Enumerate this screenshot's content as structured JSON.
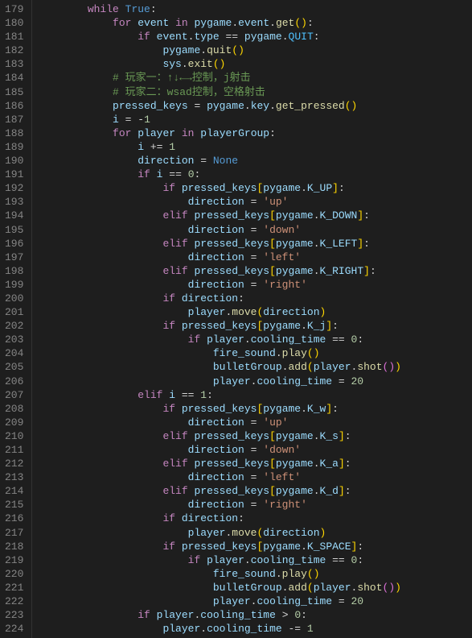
{
  "lineStart": 179,
  "lineEnd": 224,
  "code": [
    {
      "indent": 2,
      "tokens": [
        [
          "kw",
          "while"
        ],
        [
          "op",
          " "
        ],
        [
          "bool",
          "True"
        ],
        [
          "punc",
          ":"
        ]
      ]
    },
    {
      "indent": 3,
      "tokens": [
        [
          "kw",
          "for"
        ],
        [
          "op",
          " "
        ],
        [
          "var",
          "event"
        ],
        [
          "op",
          " "
        ],
        [
          "kw",
          "in"
        ],
        [
          "op",
          " "
        ],
        [
          "var",
          "pygame"
        ],
        [
          "punc",
          "."
        ],
        [
          "var",
          "event"
        ],
        [
          "punc",
          "."
        ],
        [
          "func",
          "get"
        ],
        [
          "paren",
          "()"
        ],
        [
          "punc",
          ":"
        ]
      ]
    },
    {
      "indent": 4,
      "tokens": [
        [
          "kw",
          "if"
        ],
        [
          "op",
          " "
        ],
        [
          "var",
          "event"
        ],
        [
          "punc",
          "."
        ],
        [
          "var",
          "type"
        ],
        [
          "op",
          " == "
        ],
        [
          "var",
          "pygame"
        ],
        [
          "punc",
          "."
        ],
        [
          "const",
          "QUIT"
        ],
        [
          "punc",
          ":"
        ]
      ]
    },
    {
      "indent": 5,
      "tokens": [
        [
          "var",
          "pygame"
        ],
        [
          "punc",
          "."
        ],
        [
          "func",
          "quit"
        ],
        [
          "paren",
          "()"
        ]
      ]
    },
    {
      "indent": 5,
      "tokens": [
        [
          "var",
          "sys"
        ],
        [
          "punc",
          "."
        ],
        [
          "func",
          "exit"
        ],
        [
          "paren",
          "()"
        ]
      ]
    },
    {
      "indent": 3,
      "tokens": [
        [
          "comment",
          "# 玩家一：↑↓←→控制，j射击"
        ]
      ]
    },
    {
      "indent": 3,
      "tokens": [
        [
          "comment",
          "# 玩家二：wsad控制，空格射击"
        ]
      ]
    },
    {
      "indent": 3,
      "tokens": [
        [
          "var",
          "pressed_keys"
        ],
        [
          "op",
          " = "
        ],
        [
          "var",
          "pygame"
        ],
        [
          "punc",
          "."
        ],
        [
          "var",
          "key"
        ],
        [
          "punc",
          "."
        ],
        [
          "func",
          "get_pressed"
        ],
        [
          "paren",
          "()"
        ]
      ]
    },
    {
      "indent": 3,
      "tokens": [
        [
          "var",
          "i"
        ],
        [
          "op",
          " = "
        ],
        [
          "op",
          "-"
        ],
        [
          "num",
          "1"
        ]
      ]
    },
    {
      "indent": 3,
      "tokens": [
        [
          "kw",
          "for"
        ],
        [
          "op",
          " "
        ],
        [
          "var",
          "player"
        ],
        [
          "op",
          " "
        ],
        [
          "kw",
          "in"
        ],
        [
          "op",
          " "
        ],
        [
          "var",
          "playerGroup"
        ],
        [
          "punc",
          ":"
        ]
      ]
    },
    {
      "indent": 4,
      "tokens": [
        [
          "var",
          "i"
        ],
        [
          "op",
          " += "
        ],
        [
          "num",
          "1"
        ]
      ]
    },
    {
      "indent": 4,
      "tokens": [
        [
          "var",
          "direction"
        ],
        [
          "op",
          " = "
        ],
        [
          "bool",
          "None"
        ]
      ]
    },
    {
      "indent": 4,
      "tokens": [
        [
          "kw",
          "if"
        ],
        [
          "op",
          " "
        ],
        [
          "var",
          "i"
        ],
        [
          "op",
          " == "
        ],
        [
          "num",
          "0"
        ],
        [
          "punc",
          ":"
        ]
      ]
    },
    {
      "indent": 5,
      "tokens": [
        [
          "kw",
          "if"
        ],
        [
          "op",
          " "
        ],
        [
          "var",
          "pressed_keys"
        ],
        [
          "paren",
          "["
        ],
        [
          "var",
          "pygame"
        ],
        [
          "punc",
          "."
        ],
        [
          "var",
          "K_UP"
        ],
        [
          "paren",
          "]"
        ],
        [
          "punc",
          ":"
        ]
      ]
    },
    {
      "indent": 6,
      "tokens": [
        [
          "var",
          "direction"
        ],
        [
          "op",
          " = "
        ],
        [
          "str",
          "'up'"
        ]
      ]
    },
    {
      "indent": 5,
      "tokens": [
        [
          "kw",
          "elif"
        ],
        [
          "op",
          " "
        ],
        [
          "var",
          "pressed_keys"
        ],
        [
          "paren",
          "["
        ],
        [
          "var",
          "pygame"
        ],
        [
          "punc",
          "."
        ],
        [
          "var",
          "K_DOWN"
        ],
        [
          "paren",
          "]"
        ],
        [
          "punc",
          ":"
        ]
      ]
    },
    {
      "indent": 6,
      "tokens": [
        [
          "var",
          "direction"
        ],
        [
          "op",
          " = "
        ],
        [
          "str",
          "'down'"
        ]
      ]
    },
    {
      "indent": 5,
      "tokens": [
        [
          "kw",
          "elif"
        ],
        [
          "op",
          " "
        ],
        [
          "var",
          "pressed_keys"
        ],
        [
          "paren",
          "["
        ],
        [
          "var",
          "pygame"
        ],
        [
          "punc",
          "."
        ],
        [
          "var",
          "K_LEFT"
        ],
        [
          "paren",
          "]"
        ],
        [
          "punc",
          ":"
        ]
      ]
    },
    {
      "indent": 6,
      "tokens": [
        [
          "var",
          "direction"
        ],
        [
          "op",
          " = "
        ],
        [
          "str",
          "'left'"
        ]
      ]
    },
    {
      "indent": 5,
      "tokens": [
        [
          "kw",
          "elif"
        ],
        [
          "op",
          " "
        ],
        [
          "var",
          "pressed_keys"
        ],
        [
          "paren",
          "["
        ],
        [
          "var",
          "pygame"
        ],
        [
          "punc",
          "."
        ],
        [
          "var",
          "K_RIGHT"
        ],
        [
          "paren",
          "]"
        ],
        [
          "punc",
          ":"
        ]
      ]
    },
    {
      "indent": 6,
      "tokens": [
        [
          "var",
          "direction"
        ],
        [
          "op",
          " = "
        ],
        [
          "str",
          "'right'"
        ]
      ]
    },
    {
      "indent": 5,
      "tokens": [
        [
          "kw",
          "if"
        ],
        [
          "op",
          " "
        ],
        [
          "var",
          "direction"
        ],
        [
          "punc",
          ":"
        ]
      ]
    },
    {
      "indent": 6,
      "tokens": [
        [
          "var",
          "player"
        ],
        [
          "punc",
          "."
        ],
        [
          "func",
          "move"
        ],
        [
          "paren",
          "("
        ],
        [
          "var",
          "direction"
        ],
        [
          "paren",
          ")"
        ]
      ]
    },
    {
      "indent": 5,
      "tokens": [
        [
          "kw",
          "if"
        ],
        [
          "op",
          " "
        ],
        [
          "var",
          "pressed_keys"
        ],
        [
          "paren",
          "["
        ],
        [
          "var",
          "pygame"
        ],
        [
          "punc",
          "."
        ],
        [
          "var",
          "K_j"
        ],
        [
          "paren",
          "]"
        ],
        [
          "punc",
          ":"
        ]
      ]
    },
    {
      "indent": 6,
      "tokens": [
        [
          "kw",
          "if"
        ],
        [
          "op",
          " "
        ],
        [
          "var",
          "player"
        ],
        [
          "punc",
          "."
        ],
        [
          "var",
          "cooling_time"
        ],
        [
          "op",
          " == "
        ],
        [
          "num",
          "0"
        ],
        [
          "punc",
          ":"
        ]
      ]
    },
    {
      "indent": 7,
      "tokens": [
        [
          "var",
          "fire_sound"
        ],
        [
          "punc",
          "."
        ],
        [
          "func",
          "play"
        ],
        [
          "paren",
          "()"
        ]
      ]
    },
    {
      "indent": 7,
      "tokens": [
        [
          "var",
          "bulletGroup"
        ],
        [
          "punc",
          "."
        ],
        [
          "func",
          "add"
        ],
        [
          "paren",
          "("
        ],
        [
          "var",
          "player"
        ],
        [
          "punc",
          "."
        ],
        [
          "func",
          "shot"
        ],
        [
          "paren2",
          "()"
        ],
        [
          "paren",
          ")"
        ]
      ]
    },
    {
      "indent": 7,
      "tokens": [
        [
          "var",
          "player"
        ],
        [
          "punc",
          "."
        ],
        [
          "var",
          "cooling_time"
        ],
        [
          "op",
          " = "
        ],
        [
          "num",
          "20"
        ]
      ]
    },
    {
      "indent": 4,
      "tokens": [
        [
          "kw",
          "elif"
        ],
        [
          "op",
          " "
        ],
        [
          "var",
          "i"
        ],
        [
          "op",
          " == "
        ],
        [
          "num",
          "1"
        ],
        [
          "punc",
          ":"
        ]
      ]
    },
    {
      "indent": 5,
      "tokens": [
        [
          "kw",
          "if"
        ],
        [
          "op",
          " "
        ],
        [
          "var",
          "pressed_keys"
        ],
        [
          "paren",
          "["
        ],
        [
          "var",
          "pygame"
        ],
        [
          "punc",
          "."
        ],
        [
          "var",
          "K_w"
        ],
        [
          "paren",
          "]"
        ],
        [
          "punc",
          ":"
        ]
      ]
    },
    {
      "indent": 6,
      "tokens": [
        [
          "var",
          "direction"
        ],
        [
          "op",
          " = "
        ],
        [
          "str",
          "'up'"
        ]
      ]
    },
    {
      "indent": 5,
      "tokens": [
        [
          "kw",
          "elif"
        ],
        [
          "op",
          " "
        ],
        [
          "var",
          "pressed_keys"
        ],
        [
          "paren",
          "["
        ],
        [
          "var",
          "pygame"
        ],
        [
          "punc",
          "."
        ],
        [
          "var",
          "K_s"
        ],
        [
          "paren",
          "]"
        ],
        [
          "punc",
          ":"
        ]
      ]
    },
    {
      "indent": 6,
      "tokens": [
        [
          "var",
          "direction"
        ],
        [
          "op",
          " = "
        ],
        [
          "str",
          "'down'"
        ]
      ]
    },
    {
      "indent": 5,
      "tokens": [
        [
          "kw",
          "elif"
        ],
        [
          "op",
          " "
        ],
        [
          "var",
          "pressed_keys"
        ],
        [
          "paren",
          "["
        ],
        [
          "var",
          "pygame"
        ],
        [
          "punc",
          "."
        ],
        [
          "var",
          "K_a"
        ],
        [
          "paren",
          "]"
        ],
        [
          "punc",
          ":"
        ]
      ]
    },
    {
      "indent": 6,
      "tokens": [
        [
          "var",
          "direction"
        ],
        [
          "op",
          " = "
        ],
        [
          "str",
          "'left'"
        ]
      ]
    },
    {
      "indent": 5,
      "tokens": [
        [
          "kw",
          "elif"
        ],
        [
          "op",
          " "
        ],
        [
          "var",
          "pressed_keys"
        ],
        [
          "paren",
          "["
        ],
        [
          "var",
          "pygame"
        ],
        [
          "punc",
          "."
        ],
        [
          "var",
          "K_d"
        ],
        [
          "paren",
          "]"
        ],
        [
          "punc",
          ":"
        ]
      ]
    },
    {
      "indent": 6,
      "tokens": [
        [
          "var",
          "direction"
        ],
        [
          "op",
          " = "
        ],
        [
          "str",
          "'right'"
        ]
      ]
    },
    {
      "indent": 5,
      "tokens": [
        [
          "kw",
          "if"
        ],
        [
          "op",
          " "
        ],
        [
          "var",
          "direction"
        ],
        [
          "punc",
          ":"
        ]
      ]
    },
    {
      "indent": 6,
      "tokens": [
        [
          "var",
          "player"
        ],
        [
          "punc",
          "."
        ],
        [
          "func",
          "move"
        ],
        [
          "paren",
          "("
        ],
        [
          "var",
          "direction"
        ],
        [
          "paren",
          ")"
        ]
      ]
    },
    {
      "indent": 5,
      "tokens": [
        [
          "kw",
          "if"
        ],
        [
          "op",
          " "
        ],
        [
          "var",
          "pressed_keys"
        ],
        [
          "paren",
          "["
        ],
        [
          "var",
          "pygame"
        ],
        [
          "punc",
          "."
        ],
        [
          "var",
          "K_SPACE"
        ],
        [
          "paren",
          "]"
        ],
        [
          "punc",
          ":"
        ]
      ]
    },
    {
      "indent": 6,
      "tokens": [
        [
          "kw",
          "if"
        ],
        [
          "op",
          " "
        ],
        [
          "var",
          "player"
        ],
        [
          "punc",
          "."
        ],
        [
          "var",
          "cooling_time"
        ],
        [
          "op",
          " == "
        ],
        [
          "num",
          "0"
        ],
        [
          "punc",
          ":"
        ]
      ]
    },
    {
      "indent": 7,
      "tokens": [
        [
          "var",
          "fire_sound"
        ],
        [
          "punc",
          "."
        ],
        [
          "func",
          "play"
        ],
        [
          "paren",
          "()"
        ]
      ]
    },
    {
      "indent": 7,
      "tokens": [
        [
          "var",
          "bulletGroup"
        ],
        [
          "punc",
          "."
        ],
        [
          "func",
          "add"
        ],
        [
          "paren",
          "("
        ],
        [
          "var",
          "player"
        ],
        [
          "punc",
          "."
        ],
        [
          "func",
          "shot"
        ],
        [
          "paren2",
          "()"
        ],
        [
          "paren",
          ")"
        ]
      ]
    },
    {
      "indent": 7,
      "tokens": [
        [
          "var",
          "player"
        ],
        [
          "punc",
          "."
        ],
        [
          "var",
          "cooling_time"
        ],
        [
          "op",
          " = "
        ],
        [
          "num",
          "20"
        ]
      ]
    },
    {
      "indent": 4,
      "tokens": [
        [
          "kw",
          "if"
        ],
        [
          "op",
          " "
        ],
        [
          "var",
          "player"
        ],
        [
          "punc",
          "."
        ],
        [
          "var",
          "cooling_time"
        ],
        [
          "op",
          " > "
        ],
        [
          "num",
          "0"
        ],
        [
          "punc",
          ":"
        ]
      ]
    },
    {
      "indent": 5,
      "tokens": [
        [
          "var",
          "player"
        ],
        [
          "punc",
          "."
        ],
        [
          "var",
          "cooling_time"
        ],
        [
          "op",
          " -= "
        ],
        [
          "num",
          "1"
        ]
      ]
    }
  ]
}
